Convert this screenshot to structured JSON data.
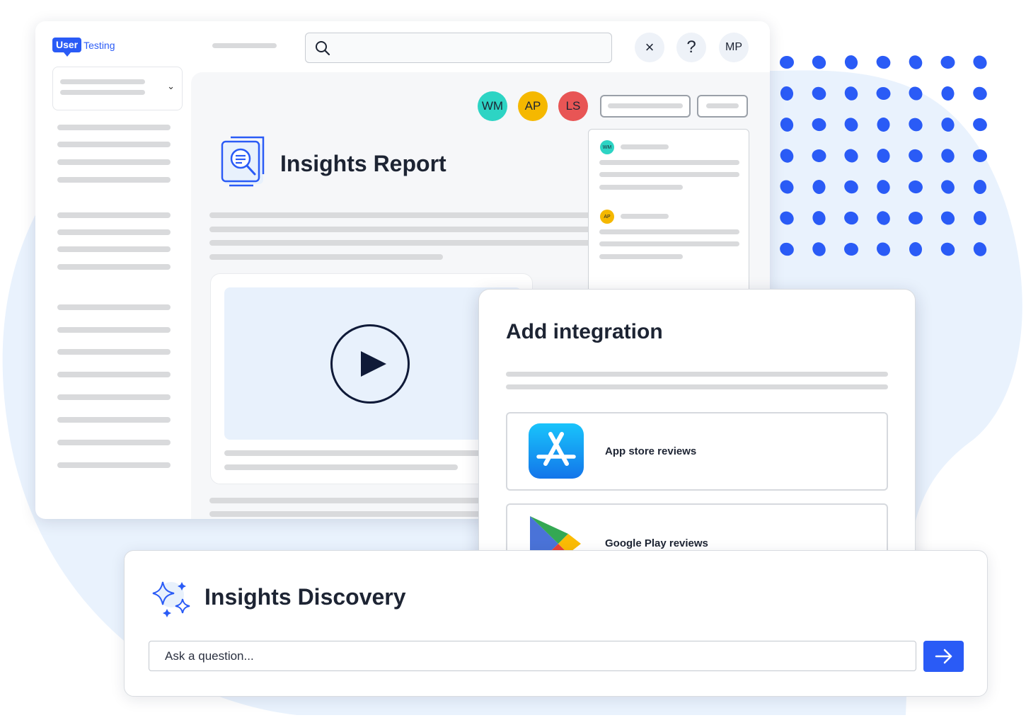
{
  "colors": {
    "accent": "#2a5bf6",
    "background_blob": "#e9f2fd",
    "avatar_wm": "#2dd4c4",
    "avatar_ap": "#f5b800",
    "avatar_ls": "#e85555"
  },
  "logo": {
    "part1": "User",
    "part2": "Testing"
  },
  "header": {
    "close_icon": "×",
    "help_icon": "?",
    "user_initials": "MP"
  },
  "collaborators": [
    {
      "initials": "WM"
    },
    {
      "initials": "AP"
    },
    {
      "initials": "LS"
    }
  ],
  "report": {
    "title": "Insights Report"
  },
  "comments": [
    {
      "initials": "WM"
    },
    {
      "initials": "AP"
    }
  ],
  "integration": {
    "title": "Add integration",
    "options": [
      {
        "label": "App store reviews",
        "icon": "app-store-icon"
      },
      {
        "label": "Google Play reviews",
        "icon": "google-play-icon"
      }
    ]
  },
  "discovery": {
    "title": "Insights Discovery",
    "placeholder": "Ask a question..."
  }
}
